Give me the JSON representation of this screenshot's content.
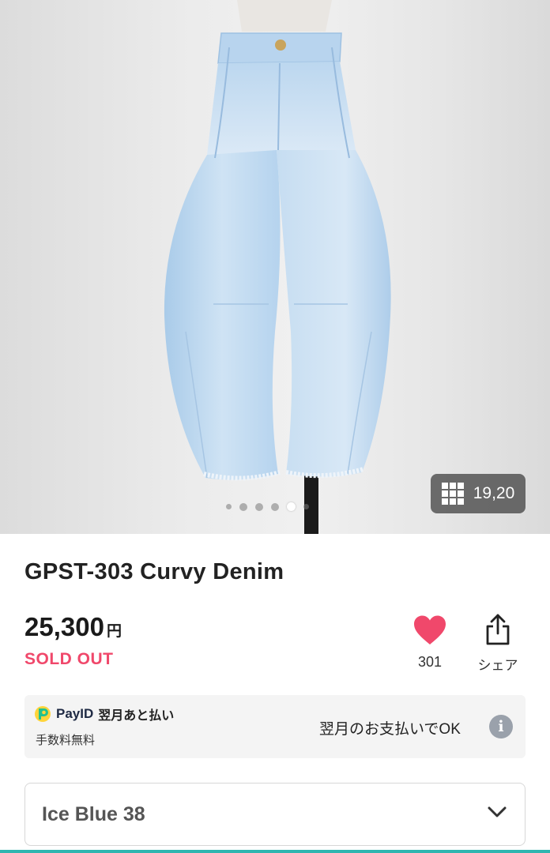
{
  "product": {
    "title": "GPST-303 Curvy Denim",
    "price": "25,300",
    "currency": "円",
    "status": "SOLD OUT"
  },
  "gallery": {
    "image_count_label": "19,20",
    "image_icon": "grid-icon",
    "dots_total": 6,
    "active_dot": 5
  },
  "actions": {
    "favorite_count": "301",
    "favorite_icon": "heart-icon",
    "share_label": "シェア",
    "share_icon": "share-icon"
  },
  "payment": {
    "brand": "PayID",
    "plan": "翌月あと払い",
    "fee_note": "手数料無料",
    "message": "翌月のお支払いでOK",
    "info_icon": "info-icon"
  },
  "variant": {
    "selected": "Ice Blue 38",
    "icon": "chevron-down-icon"
  },
  "colors": {
    "sold_out": "#f0486b",
    "heart": "#f0486b",
    "accent": "#2fb6b0",
    "denim": "#b9d6ee"
  }
}
